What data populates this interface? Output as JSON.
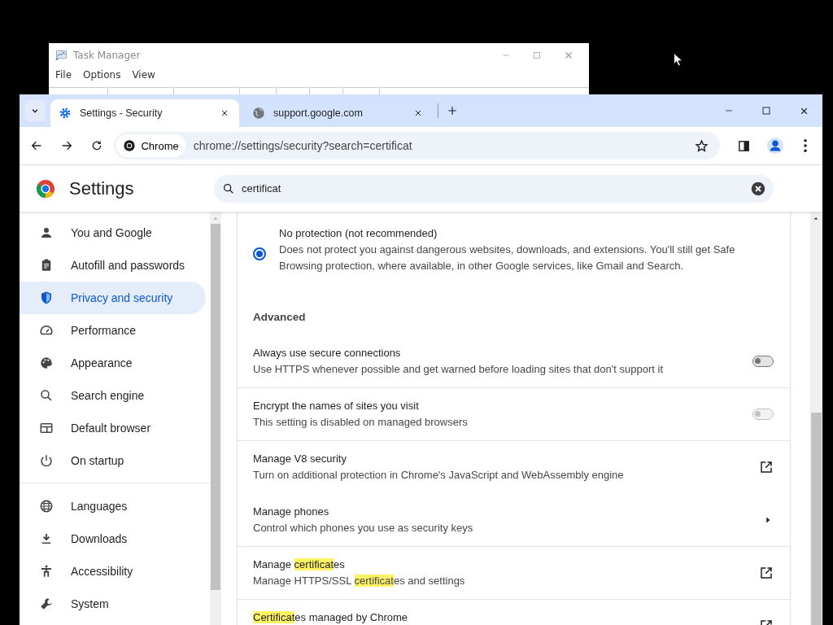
{
  "background_window": {
    "title": "Task Manager",
    "menu": [
      "File",
      "Options",
      "View"
    ]
  },
  "browser": {
    "tabs": [
      {
        "title": "Settings - Security",
        "selected": true
      },
      {
        "title": "support.google.com",
        "selected": false
      }
    ],
    "address": {
      "chip": "Chrome",
      "url": "chrome://settings/security?search=certificat"
    }
  },
  "settings": {
    "title": "Settings",
    "search": {
      "value": "certificat"
    },
    "sidebar": {
      "groups": [
        {
          "items": [
            {
              "label": "You and Google",
              "selected": false
            },
            {
              "label": "Autofill and passwords",
              "selected": false
            },
            {
              "label": "Privacy and security",
              "selected": true
            },
            {
              "label": "Performance",
              "selected": false
            },
            {
              "label": "Appearance",
              "selected": false
            },
            {
              "label": "Search engine",
              "selected": false
            },
            {
              "label": "Default browser",
              "selected": false
            },
            {
              "label": "On startup",
              "selected": false
            }
          ]
        },
        {
          "items": [
            {
              "label": "Languages",
              "selected": false
            },
            {
              "label": "Downloads",
              "selected": false
            },
            {
              "label": "Accessibility",
              "selected": false
            },
            {
              "label": "System",
              "selected": false
            }
          ]
        }
      ]
    },
    "content": {
      "radio": {
        "title": "No protection (not recommended)",
        "description": "Does not protect you against dangerous websites, downloads, and extensions. You'll still get Safe Browsing protection, where available, in other Google services, like Gmail and Search.",
        "selected": true
      },
      "section_title": "Advanced",
      "rows": [
        {
          "kind": "toggle",
          "title": [
            {
              "text": "Always use secure connections",
              "highlighted": false
            }
          ],
          "description": [
            {
              "text": "Use HTTPS whenever possible and get warned before loading sites that don't support it",
              "highlighted": false
            }
          ],
          "on": false,
          "disabled": false,
          "divider_above": false
        },
        {
          "kind": "toggle",
          "title": [
            {
              "text": "Encrypt the names of sites you visit",
              "highlighted": false
            }
          ],
          "description": [
            {
              "text": "This setting is disabled on managed browsers",
              "highlighted": false
            }
          ],
          "on": false,
          "disabled": true,
          "divider_above": true
        },
        {
          "kind": "external",
          "title": [
            {
              "text": "Manage V8 security",
              "highlighted": false
            }
          ],
          "description": [
            {
              "text": "Turn on additional protection in Chrome's JavaScript and WebAssembly engine",
              "highlighted": false
            }
          ],
          "divider_above": true
        },
        {
          "kind": "arrow",
          "title": [
            {
              "text": "Manage phones",
              "highlighted": false
            }
          ],
          "description": [
            {
              "text": "Control which phones you use as security keys",
              "highlighted": false
            }
          ],
          "divider_above": false
        },
        {
          "kind": "external",
          "title": [
            {
              "text": "Manage ",
              "highlighted": false
            },
            {
              "text": "certificat",
              "highlighted": true
            },
            {
              "text": "es",
              "highlighted": false
            }
          ],
          "description": [
            {
              "text": "Manage HTTPS/SSL ",
              "highlighted": false
            },
            {
              "text": "certificat",
              "highlighted": true
            },
            {
              "text": "es and settings",
              "highlighted": false
            }
          ],
          "divider_above": true
        },
        {
          "kind": "external",
          "title": [
            {
              "text": "Certificat",
              "highlighted": true
            },
            {
              "text": "es managed by Chrome",
              "highlighted": false
            }
          ],
          "description": [],
          "divider_above": true
        }
      ]
    }
  }
}
